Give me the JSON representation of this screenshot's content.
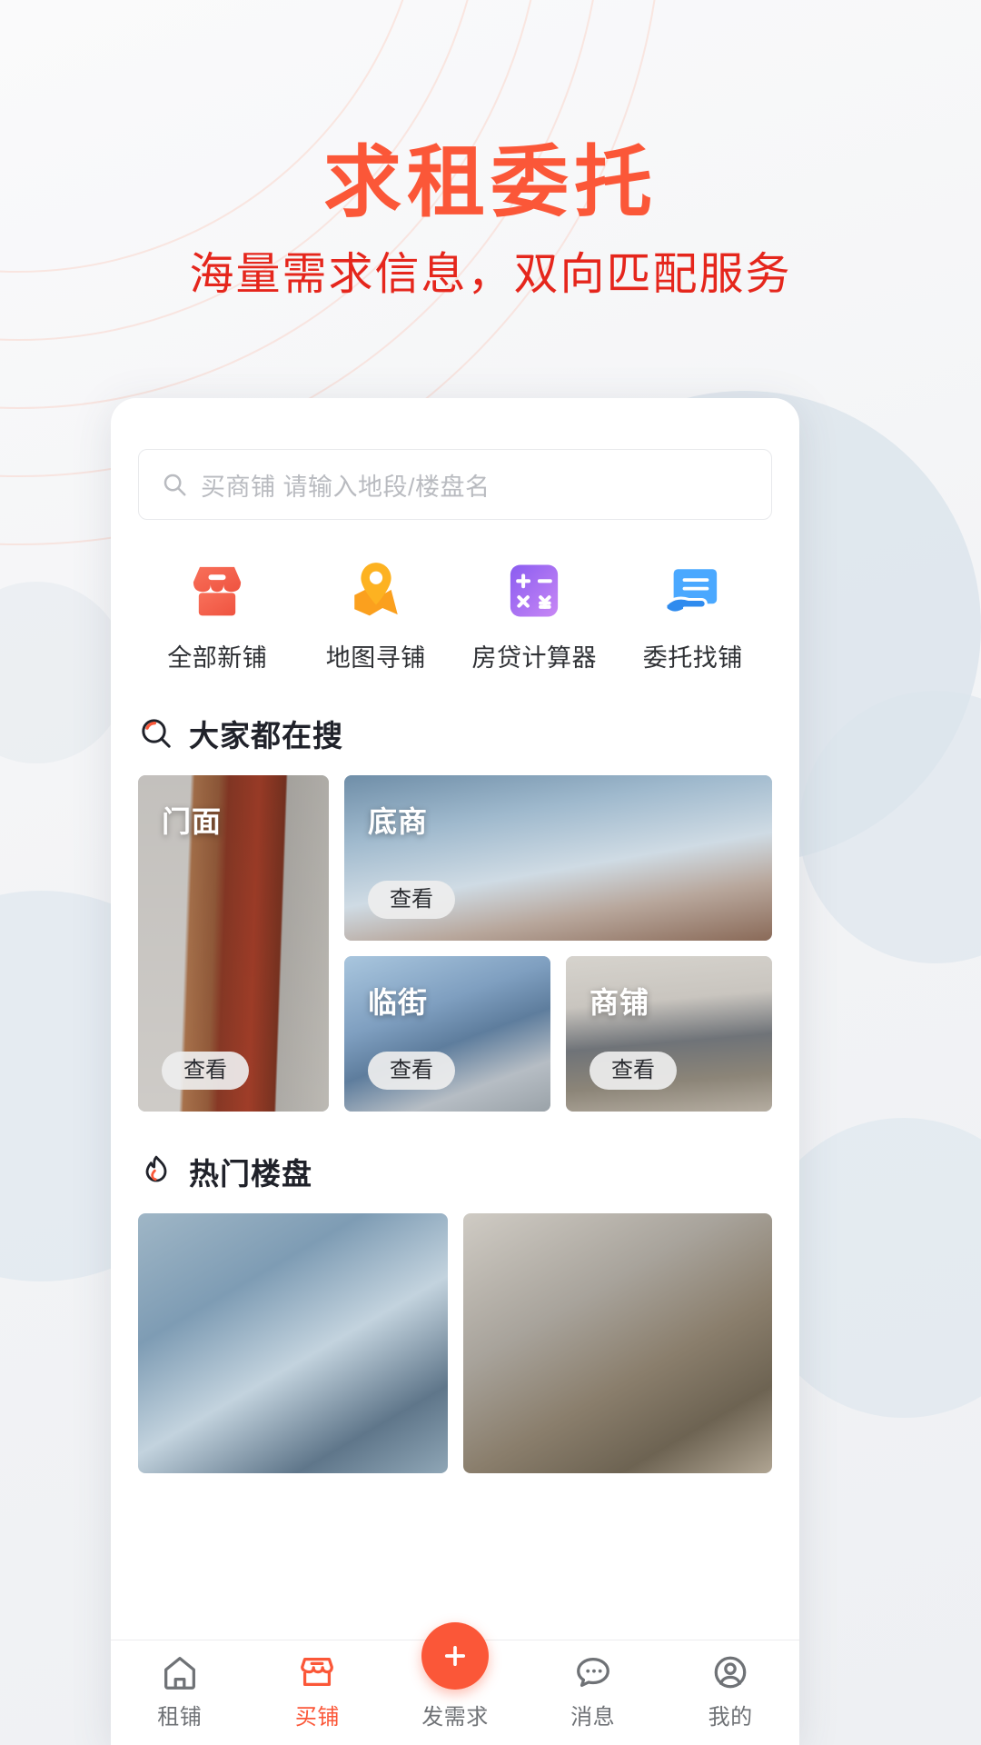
{
  "hero": {
    "title": "求租委托",
    "subtitle": "海量需求信息，双向匹配服务",
    "title_color": "#fb5738",
    "subtitle_color": "#e5261c"
  },
  "search": {
    "icon": "search-icon",
    "placeholder": "买商铺 请输入地段/楼盘名",
    "value": ""
  },
  "quick_actions": [
    {
      "label": "全部新铺",
      "icon": "shop-icon",
      "color": "#f4624c"
    },
    {
      "label": "地图寻铺",
      "icon": "map-pin-icon",
      "color": "#fba01e"
    },
    {
      "label": "房贷计算器",
      "icon": "calculator-icon",
      "color": "#9b6bf2"
    },
    {
      "label": "委托找铺",
      "icon": "hand-document-icon",
      "color": "#3e9bff"
    }
  ],
  "popular_search": {
    "icon": "search-highlight-icon",
    "title": "大家都在搜",
    "tiles": [
      {
        "label": "门面",
        "view_label": "查看"
      },
      {
        "label": "底商",
        "view_label": "查看"
      },
      {
        "label": "临街",
        "view_label": "查看"
      },
      {
        "label": "商铺",
        "view_label": "查看"
      }
    ]
  },
  "hot_listings": {
    "icon": "flame-icon",
    "title": "热门楼盘",
    "items": [
      {
        "name": "hot-listing-1"
      },
      {
        "name": "hot-listing-2"
      }
    ]
  },
  "tabbar": {
    "items": [
      {
        "label": "租铺",
        "icon": "home-icon",
        "active": false
      },
      {
        "label": "买铺",
        "icon": "shop-outline-icon",
        "active": true
      },
      {
        "label": "发需求",
        "icon": "plus-icon",
        "active": false
      },
      {
        "label": "消息",
        "icon": "chat-icon",
        "active": false
      },
      {
        "label": "我的",
        "icon": "profile-icon",
        "active": false
      }
    ],
    "accent_color": "#fb5738",
    "inactive_color": "#6f7276"
  }
}
